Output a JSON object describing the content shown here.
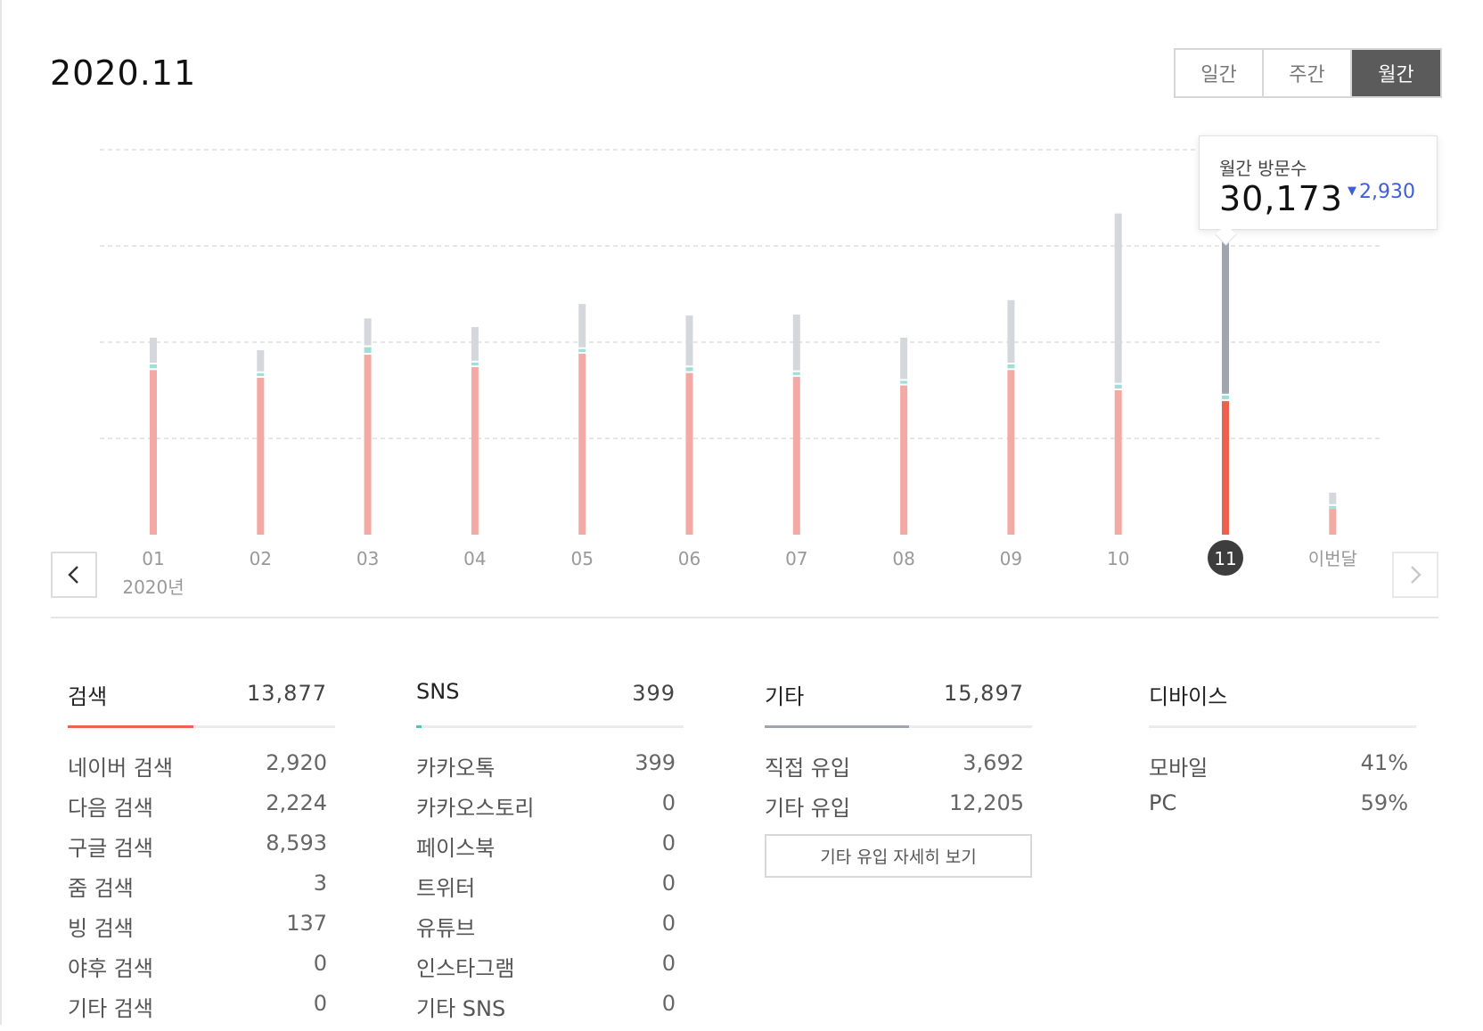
{
  "header": {
    "period": "2020.11"
  },
  "view_tabs": [
    {
      "label": "일간",
      "active": false
    },
    {
      "label": "주간",
      "active": false
    },
    {
      "label": "월간",
      "active": true
    }
  ],
  "tooltip": {
    "title": "월간 방문수",
    "value": "30,173",
    "delta": "2,930",
    "delta_direction": "down"
  },
  "chart_data": {
    "type": "bar",
    "stacked": true,
    "categories": [
      "01",
      "02",
      "03",
      "04",
      "05",
      "06",
      "07",
      "08",
      "09",
      "10",
      "11",
      "이번달"
    ],
    "year_label": "2020년",
    "selected_index": 10,
    "series": [
      {
        "values": [
          17100,
          16300,
          18700,
          17400,
          18800,
          16800,
          16400,
          15500,
          17100,
          15000,
          13877,
          2700
        ]
      },
      {
        "values": [
          400,
          300,
          600,
          300,
          300,
          400,
          300,
          300,
          400,
          400,
          399,
          100
        ]
      },
      {
        "values": [
          2600,
          2200,
          2800,
          3500,
          4500,
          5200,
          5800,
          4300,
          6500,
          17600,
          15897,
          1200
        ]
      }
    ],
    "ylim": [
      0,
      40000
    ],
    "gridlines": [
      10000,
      20000,
      30000,
      40000
    ],
    "colors": {
      "search": "#f4aaa4",
      "search_selected": "#ee6150",
      "sns": "#9edfd9",
      "other": "#d4d7dc",
      "other_selected": "#a0a6af",
      "grid": "#dddddd"
    }
  },
  "panels": [
    {
      "title": "검색",
      "total": "13,877",
      "fill_ratio": 0.47,
      "color": "#ee6150",
      "rows": [
        {
          "label": "네이버 검색",
          "value": "2,920"
        },
        {
          "label": "다음 검색",
          "value": "2,224"
        },
        {
          "label": "구글 검색",
          "value": "8,593"
        },
        {
          "label": "줌 검색",
          "value": "3"
        },
        {
          "label": "빙 검색",
          "value": "137"
        },
        {
          "label": "야후 검색",
          "value": "0"
        },
        {
          "label": "기타 검색",
          "value": "0"
        }
      ]
    },
    {
      "title": "SNS",
      "total": "399",
      "fill_ratio": 0.02,
      "color": "#4fc7b5",
      "rows": [
        {
          "label": "카카오톡",
          "value": "399"
        },
        {
          "label": "카카오스토리",
          "value": "0"
        },
        {
          "label": "페이스북",
          "value": "0"
        },
        {
          "label": "트위터",
          "value": "0"
        },
        {
          "label": "유튜브",
          "value": "0"
        },
        {
          "label": "인스타그램",
          "value": "0"
        },
        {
          "label": "기타 SNS",
          "value": "0"
        }
      ]
    },
    {
      "title": "기타",
      "total": "15,897",
      "fill_ratio": 0.54,
      "color": "#a0a6af",
      "rows": [
        {
          "label": "직접 유입",
          "value": "3,692"
        },
        {
          "label": "기타 유입",
          "value": "12,205"
        }
      ],
      "button_label": "기타 유입 자세히 보기"
    },
    {
      "title": "디바이스",
      "total": "",
      "fill_ratio": 0,
      "color": "#a0a6af",
      "rows": [
        {
          "label": "모바일",
          "value": "41%"
        },
        {
          "label": "PC",
          "value": "59%"
        }
      ]
    }
  ]
}
